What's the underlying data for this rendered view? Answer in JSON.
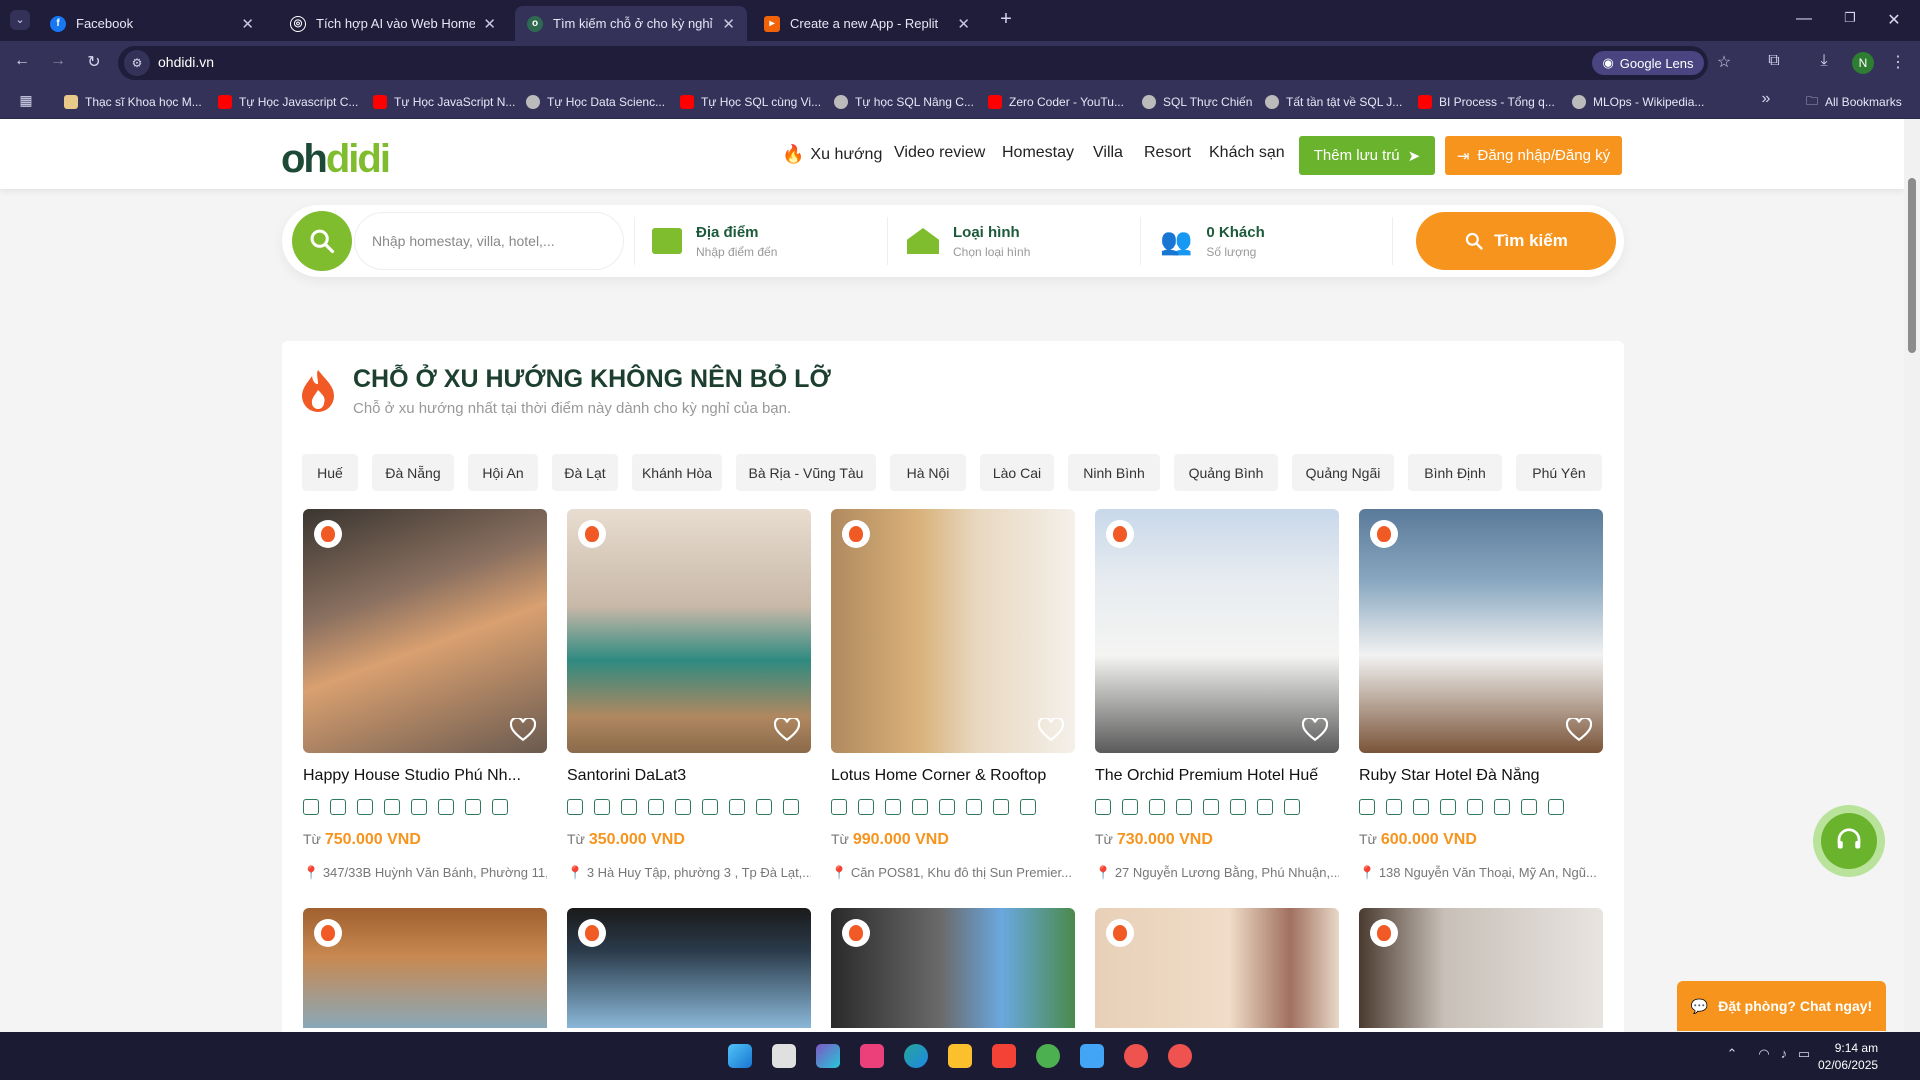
{
  "browser": {
    "tabs": [
      {
        "title": "Facebook",
        "icon": "facebook-icon",
        "color": "#1877f2"
      },
      {
        "title": "Tích hợp AI vào Web Homestay",
        "icon": "openai-icon",
        "color": "#ffffff"
      },
      {
        "title": "Tìm kiếm chỗ ở cho kỳ nghỉ của",
        "icon": "ohdidi-icon",
        "color": "#2d6a4f"
      },
      {
        "title": "Create a new App - Replit",
        "icon": "replit-icon",
        "color": "#f26207"
      }
    ],
    "url": "ohdidi.vn",
    "google_lens": "Google Lens",
    "profile_initial": "N",
    "bookmarks": [
      "Thạc sĩ Khoa học M...",
      "Tự Học Javascript C...",
      "Tự Học JavaScript N...",
      "Tự Học Data Scienc...",
      "Tự Học SQL cùng Vi...",
      "Tự học SQL Nâng C...",
      "Zero Coder - YouTu...",
      "SQL Thực Chiến",
      "Tất tần tật về SQL J...",
      "BI Process - Tổng q...",
      "MLOps - Wikipedia..."
    ],
    "all_bookmarks": "All Bookmarks"
  },
  "header": {
    "logo": "ohdidi",
    "nav": [
      "Xu hướng",
      "Video review",
      "Homestay",
      "Villa",
      "Resort",
      "Khách sạn"
    ],
    "add_listing": "Thêm lưu trú",
    "login": "Đăng nhập/Đăng ký"
  },
  "search": {
    "placeholder": "Nhập homestay, villa, hotel,...",
    "location_label": "Địa điểm",
    "location_hint": "Nhập điểm đến",
    "type_label": "Loại hình",
    "type_hint": "Chọn loại hình",
    "guests_label": "0 Khách",
    "guests_hint": "Số lượng",
    "button": "Tìm kiếm"
  },
  "section": {
    "title": "CHỖ Ở XU HƯỚNG KHÔNG NÊN BỎ LỠ",
    "subtitle": "Chỗ ở xu hướng nhất tại thời điểm này dành cho kỳ nghỉ của bạn.",
    "cities": [
      "Huế",
      "Đà Nẵng",
      "Hội An",
      "Đà Lạt",
      "Khánh Hòa",
      "Bà Rịa - Vũng Tàu",
      "Hà Nội",
      "Lào Cai",
      "Ninh Bình",
      "Quảng Bình",
      "Quảng Ngãi",
      "Bình Định",
      "Phú Yên"
    ],
    "price_prefix": "Từ",
    "properties": [
      {
        "name": "Happy House Studio Phú Nh...",
        "price": "750.000 VND",
        "address": "347/33B Huỳnh Văn Bánh, Phường 11,..."
      },
      {
        "name": "Santorini DaLat3",
        "price": "350.000 VND",
        "address": "3 Hà Huy Tập, phường 3 , Tp Đà Lạt,..."
      },
      {
        "name": "Lotus Home Corner & Rooftop",
        "price": "990.000 VND",
        "address": "Căn POS81, Khu đô thị Sun Premier..."
      },
      {
        "name": "The Orchid Premium Hotel Huế",
        "price": "730.000 VND",
        "address": "27 Nguyễn Lương Bằng, Phú Nhuận,..."
      },
      {
        "name": "Ruby Star Hotel Đà Nẵng",
        "price": "600.000 VND",
        "address": "138 Nguyễn Văn Thoại, Mỹ An, Ngũ..."
      }
    ]
  },
  "floating": {
    "chat": "Đặt phòng? Chat ngay!"
  },
  "taskbar": {
    "time": "9:14 am",
    "date": "02/06/2025"
  }
}
